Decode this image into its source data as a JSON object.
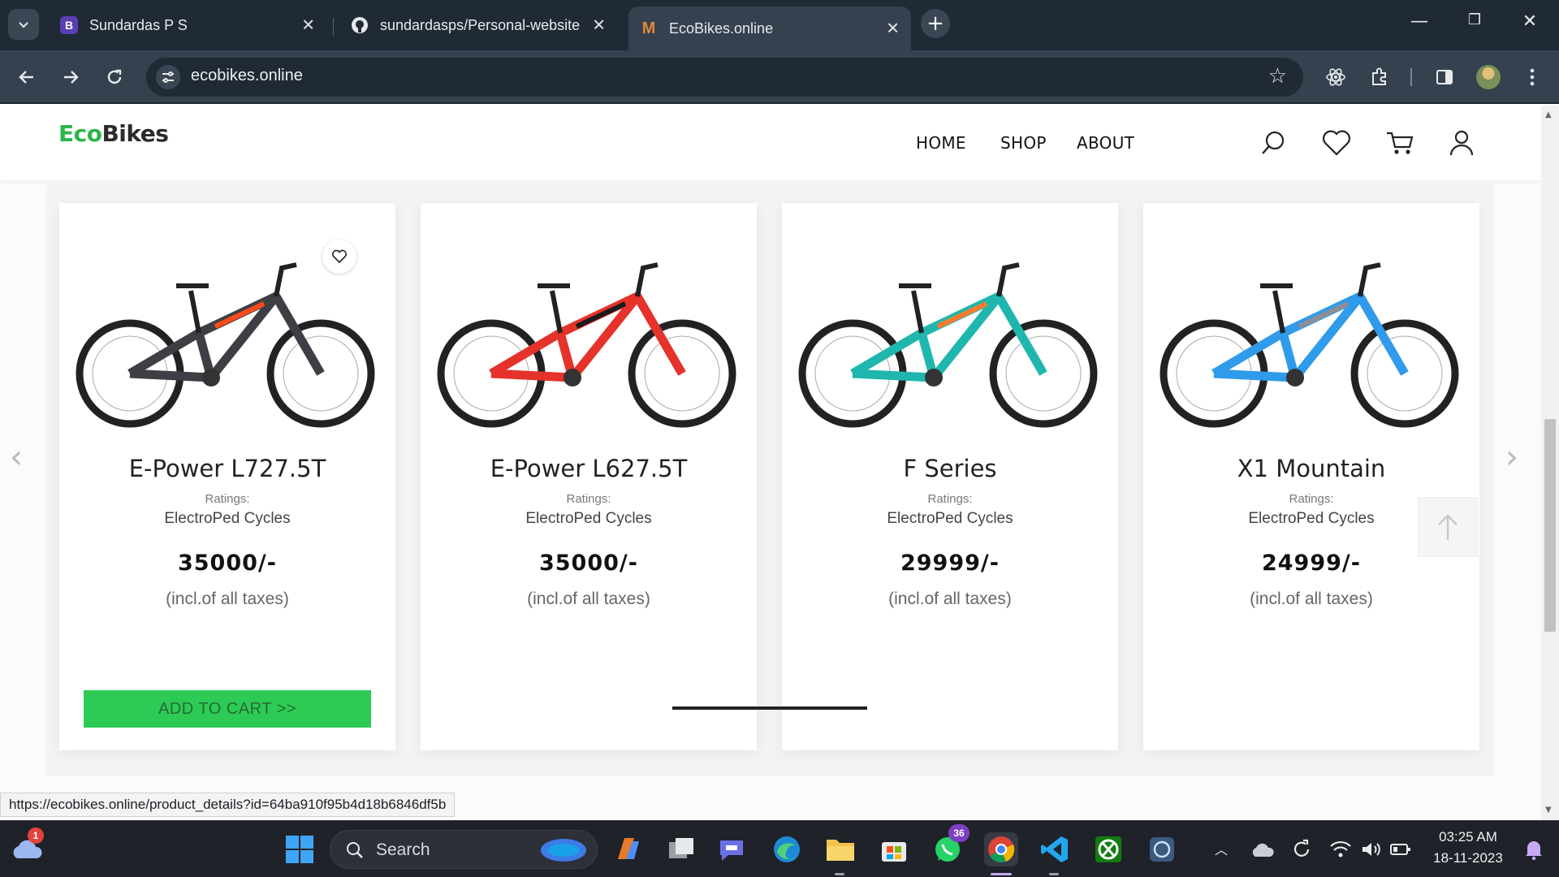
{
  "browser": {
    "tabs": [
      {
        "title": "Sundardas P S",
        "favicon": "B"
      },
      {
        "title": "sundardasps/Personal-website",
        "favicon": "github-icon"
      },
      {
        "title": "EcoBikes.online",
        "favicon": "M",
        "active": true
      }
    ],
    "url": "ecobikes.online",
    "status_url": "https://ecobikes.online/product_details?id=64ba910f95b4d18b6846df5b"
  },
  "site": {
    "logo_eco": "Eco",
    "logo_bikes": "Bikes",
    "nav": [
      "HOME",
      "SHOP",
      "ABOUT"
    ],
    "accent": "#2dcb55"
  },
  "products": [
    {
      "name": "E-Power L727.5T",
      "rating_label": "Ratings:",
      "brand": "ElectroPed Cycles",
      "price": "35000/-",
      "tax": "(incl.of all taxes)",
      "frame_color": "#3d3f44",
      "accent_color": "#ff4a1c"
    },
    {
      "name": "E-Power L627.5T",
      "rating_label": "Ratings:",
      "brand": "ElectroPed Cycles",
      "price": "35000/-",
      "tax": "(incl.of all taxes)",
      "frame_color": "#e5322b",
      "accent_color": "#1b1b1b"
    },
    {
      "name": "F Series",
      "rating_label": "Ratings:",
      "brand": "ElectroPed Cycles",
      "price": "29999/-",
      "tax": "(incl.of all taxes)",
      "frame_color": "#1fb7ad",
      "accent_color": "#ff7a2a"
    },
    {
      "name": "X1 Mountain",
      "rating_label": "Ratings:",
      "brand": "ElectroPed Cycles",
      "price": "24999/-",
      "tax": "(incl.of all taxes)",
      "frame_color": "#2f9bea",
      "accent_color": "#8c8f96"
    }
  ],
  "add_to_cart_label": "ADD TO CART >>",
  "taskbar": {
    "search_label": "Search",
    "whatsapp_badge": "36",
    "weather_badge": "1",
    "time": "03:25 AM",
    "date": "18-11-2023"
  }
}
